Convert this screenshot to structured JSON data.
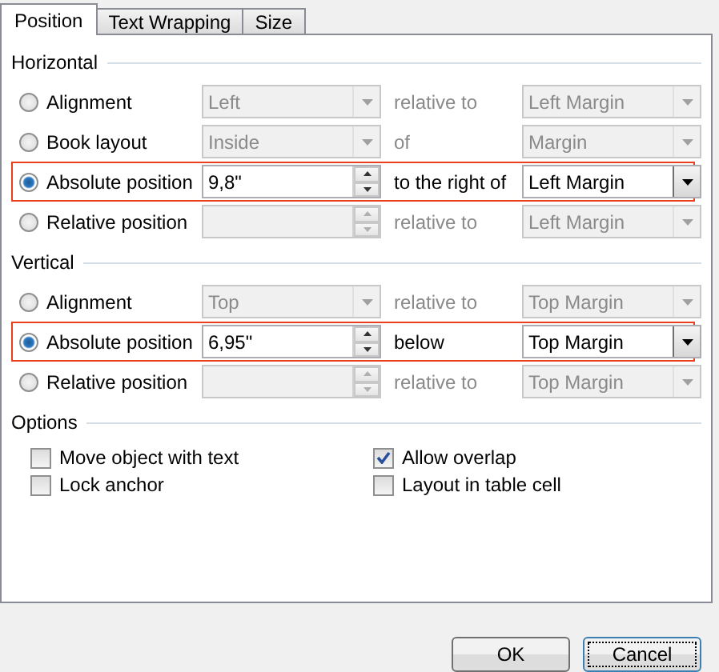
{
  "tabs": [
    {
      "label": "Position",
      "selected": true
    },
    {
      "label": "Text Wrapping",
      "selected": false
    },
    {
      "label": "Size",
      "selected": false
    }
  ],
  "sections": [
    {
      "title": "Horizontal",
      "rows": [
        {
          "label": "Alignment",
          "selected": false,
          "disabled": true,
          "highlighted": false,
          "kind": "combo",
          "value": "Left",
          "relation": "relative to",
          "target": "Left Margin"
        },
        {
          "label": "Book layout",
          "selected": false,
          "disabled": true,
          "highlighted": false,
          "kind": "combo",
          "value": "Inside",
          "relation": "of",
          "target": "Margin"
        },
        {
          "label": "Absolute position",
          "selected": true,
          "disabled": false,
          "highlighted": true,
          "kind": "spin",
          "value": "9,8\"",
          "relation": "to the right of",
          "target": "Left Margin"
        },
        {
          "label": "Relative position",
          "selected": false,
          "disabled": true,
          "highlighted": false,
          "kind": "spin",
          "relation": "relative to",
          "target": "Left Margin"
        }
      ]
    },
    {
      "title": "Vertical",
      "rows": [
        {
          "label": "Alignment",
          "selected": false,
          "disabled": true,
          "highlighted": false,
          "kind": "combo",
          "value": "Top",
          "relation": "relative to",
          "target": "Top Margin"
        },
        {
          "label": "Absolute position",
          "selected": true,
          "disabled": false,
          "highlighted": true,
          "kind": "spin",
          "value": "6,95\"",
          "relation": "below",
          "target": "Top Margin"
        },
        {
          "label": "Relative position",
          "selected": false,
          "disabled": true,
          "highlighted": false,
          "kind": "spin",
          "relation": "relative to",
          "target": "Top Margin"
        }
      ]
    }
  ],
  "options": {
    "title": "Options",
    "items": [
      {
        "label": "Move object with text",
        "checked": false
      },
      {
        "label": "Allow overlap",
        "checked": true
      },
      {
        "label": "Lock anchor",
        "checked": false
      },
      {
        "label": "Layout in table cell",
        "checked": false
      }
    ]
  },
  "buttons": [
    {
      "label": "OK",
      "focused": false
    },
    {
      "label": "Cancel",
      "focused": true
    }
  ]
}
